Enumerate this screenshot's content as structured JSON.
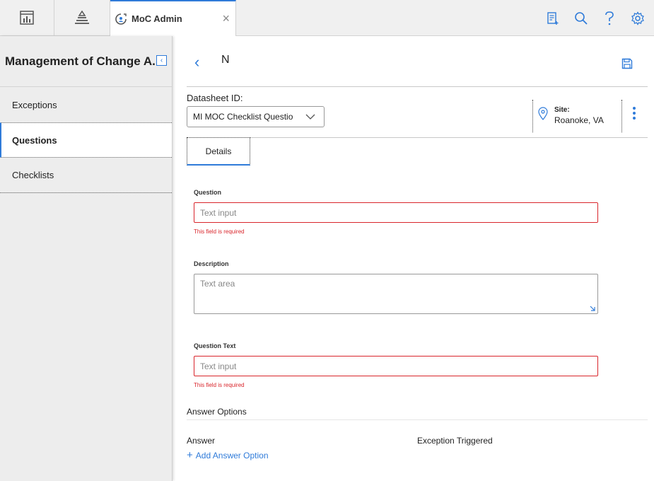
{
  "topbar": {
    "active_tab_title": "MoC Admin",
    "close_glyph": "×",
    "icons": [
      "dashboard-icon",
      "asset-hierarchy-icon",
      "moc-admin-icon",
      "new-record-icon",
      "search-icon",
      "help-icon",
      "settings-icon"
    ]
  },
  "sidebar": {
    "title": "Management of Change A...",
    "collapse_glyph": "‹",
    "items": [
      {
        "label": "Exceptions"
      },
      {
        "label": "Questions"
      },
      {
        "label": "Checklists"
      }
    ],
    "active_item": "Questions"
  },
  "main": {
    "back_glyph": "‹",
    "record_title": "N",
    "datasheet_label": "Datasheet ID:",
    "datasheet_value": "MI MOC Checklist Questio",
    "site_label": "Site:",
    "site_value": "Roanoke, VA",
    "tabs": [
      {
        "label": "Details"
      }
    ],
    "fields": {
      "question": {
        "label": "Question",
        "placeholder": "Text input",
        "error": "This field is required"
      },
      "description": {
        "label": "Description",
        "placeholder": "Text area"
      },
      "question_text": {
        "label": "Question Text",
        "placeholder": "Text input",
        "error": "This field is required"
      }
    },
    "answer_options": {
      "title": "Answer Options",
      "col_answer": "Answer",
      "col_exception": "Exception Triggered",
      "add_label": "Add Answer Option",
      "add_glyph": "+"
    }
  },
  "colors": {
    "accent": "#2f7bd9",
    "error": "#d9252b"
  }
}
